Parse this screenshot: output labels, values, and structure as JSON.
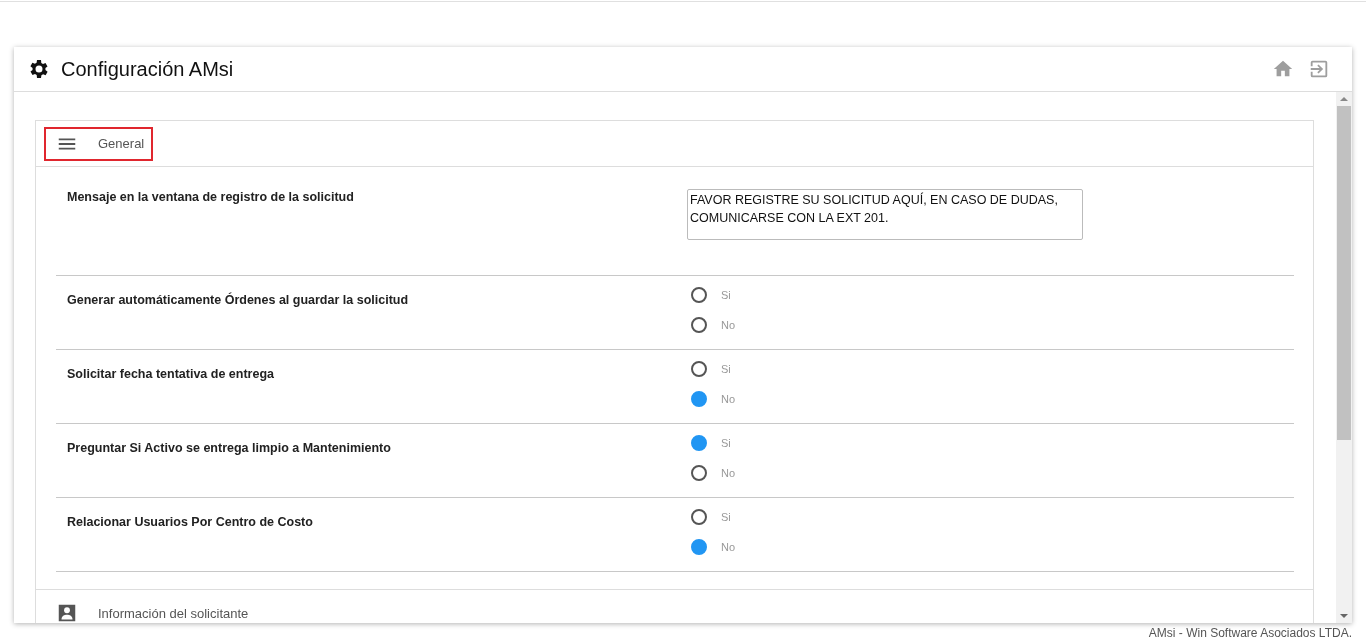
{
  "window": {
    "title": "Configuración AMsi"
  },
  "sections": [
    {
      "title": "General",
      "kind": "menu",
      "highlighted": true,
      "expanded": true,
      "settings": [
        {
          "kind": "text",
          "label": "Mensaje en la ventana de registro de la solicitud",
          "value": "FAVOR REGISTRE SU SOLICITUD AQUÍ, EN CASO DE DUDAS, COMUNICARSE CON LA EXT 201."
        },
        {
          "kind": "radio",
          "label": "Generar automáticamente Órdenes al guardar la solicitud",
          "options": [
            {
              "label": "Si",
              "selected": false
            },
            {
              "label": "No",
              "selected": false
            }
          ]
        },
        {
          "kind": "radio",
          "label": "Solicitar fecha tentativa de entrega",
          "options": [
            {
              "label": "Si",
              "selected": false
            },
            {
              "label": "No",
              "selected": true
            }
          ]
        },
        {
          "kind": "radio",
          "label": "Preguntar Si Activo se entrega limpio a Mantenimiento",
          "options": [
            {
              "label": "Si",
              "selected": true
            },
            {
              "label": "No",
              "selected": false
            }
          ]
        },
        {
          "kind": "radio",
          "label": "Relacionar Usuarios Por Centro de Costo",
          "options": [
            {
              "label": "Si",
              "selected": false
            },
            {
              "label": "No",
              "selected": true
            }
          ]
        }
      ]
    },
    {
      "title": "Información del solicitante",
      "kind": "person",
      "highlighted": false,
      "expanded": false
    }
  ],
  "footer": "AMsi - Win Software Asociados LTDA."
}
